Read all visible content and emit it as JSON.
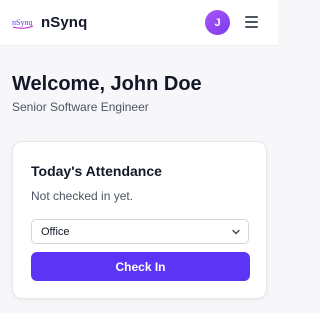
{
  "header": {
    "logo_text": "nSynq",
    "brand": "nSynq",
    "avatar_initial": "J",
    "menu_icon": "hamburger-menu-icon"
  },
  "welcome": {
    "greeting": "Welcome, John Doe",
    "role": "Senior Software Engineer"
  },
  "attendance": {
    "title": "Today's Attendance",
    "status": "Not checked in yet.",
    "location_select": {
      "value": "Office",
      "icon": "chevron-down-icon"
    },
    "check_in_label": "Check In"
  },
  "colors": {
    "accent": "#5b34f5",
    "avatar": "#8b5cf6",
    "background": "#f7f7f9"
  }
}
